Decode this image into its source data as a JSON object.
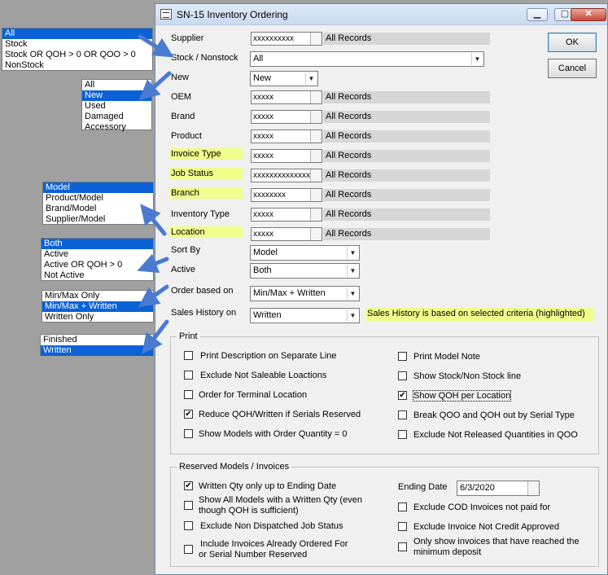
{
  "window": {
    "title": "SN-15  Inventory Ordering",
    "minimize": "▁",
    "maximize": "▢",
    "close": "✕"
  },
  "buttons": {
    "ok": "OK",
    "cancel": "Cancel"
  },
  "callouts": {
    "stock": [
      "All",
      "Stock",
      "Stock OR QOH > 0 OR QOO > 0",
      "NonStock"
    ],
    "new": [
      "All",
      "New",
      "Used",
      "Damaged",
      "Accessory"
    ],
    "sort": [
      "Model",
      "Product/Model",
      "Brand/Model",
      "Supplier/Model"
    ],
    "active": [
      "Both",
      "Active",
      "Active OR QOH > 0",
      "Not Active"
    ],
    "order": [
      "Min/Max Only",
      "Min/Max + Written",
      "Written Only"
    ],
    "history": [
      "Finished",
      "Written"
    ]
  },
  "fields": {
    "supplier": {
      "label": "Supplier",
      "code": "xxxxxxxxxx",
      "value": "All Records"
    },
    "stock": {
      "label": "Stock / Nonstock",
      "value": "All"
    },
    "new": {
      "label": "New",
      "value": "New"
    },
    "oem": {
      "label": "OEM",
      "code": "xxxxx",
      "value": "All Records"
    },
    "brand": {
      "label": "Brand",
      "code": "xxxxx",
      "value": "All Records"
    },
    "product": {
      "label": "Product",
      "code": "xxxxx",
      "value": "All Records"
    },
    "invoice_type": {
      "label": "Invoice Type",
      "code": "xxxxx",
      "value": "All Records"
    },
    "job_status": {
      "label": "Job Status",
      "code": "xxxxxxxxxxxxxxxx",
      "value": "All Records"
    },
    "branch": {
      "label": "Branch",
      "code": "xxxxxxxx",
      "value": "All Records"
    },
    "inventory_type": {
      "label": "Inventory Type",
      "code": "xxxxx",
      "value": "All Records"
    },
    "location": {
      "label": "Location",
      "code": "xxxxx",
      "value": "All Records"
    },
    "sort_by": {
      "label": "Sort By",
      "value": "Model"
    },
    "active": {
      "label": "Active",
      "value": "Both"
    },
    "order_based_on": {
      "label": "Order based on",
      "value": "Min/Max + Written"
    },
    "sales_history": {
      "label": "Sales History on",
      "value": "Written",
      "note": "Sales History is based on selected criteria (highlighted)"
    }
  },
  "print": {
    "title": "Print",
    "left": [
      {
        "label": "Print Description on Separate Line",
        "checked": false
      },
      {
        "label": "Exclude Not Saleable Loactions",
        "checked": false
      },
      {
        "label": "Order for Terminal Location",
        "checked": false
      },
      {
        "label": "Reduce QOH/Written if Serials Reserved",
        "checked": true
      },
      {
        "label": "Show Models with Order Quantity = 0",
        "checked": false
      }
    ],
    "right": [
      {
        "label": "Print Model Note",
        "checked": false
      },
      {
        "label": "Show Stock/Non Stock line",
        "checked": false
      },
      {
        "label": "Show QOH per Location",
        "checked": true
      },
      {
        "label": "Break QOO and QOH out by Serial Type",
        "checked": false
      },
      {
        "label": "Exclude Not Released Quantities in  QOO",
        "checked": false
      }
    ]
  },
  "reserved": {
    "title": "Reserved Models / Invoices",
    "written_qty": {
      "label": "Written Qty only up to Ending Date",
      "checked": true
    },
    "show_all_models": {
      "line1": "Show All Models with a Written Qty (even",
      "line2": "though QOH is sufficient)",
      "checked": false
    },
    "exclude_non_dispatched": {
      "label": "Exclude Non Dispatched Job Status",
      "checked": false
    },
    "include_invoices": {
      "line1": "Include Invoices Already Ordered For",
      "line2": "or Serial Number Reserved",
      "checked": false
    },
    "ending_date": {
      "label": "Ending Date",
      "value": "6/3/2020"
    },
    "exclude_cod": {
      "label": "Exclude COD Invoices not paid for",
      "checked": false
    },
    "exclude_not_credit": {
      "label": "Exclude Invoice Not Credit Approved",
      "checked": false
    },
    "min_deposit": {
      "line1": "Only show invoices that have reached the",
      "line2": "minimum deposit",
      "checked": false
    }
  },
  "check_glyph": "✔",
  "colors": {
    "highlight": "#f0fe8c",
    "selection": "#0a62d6",
    "arrow": "#4a7bd0"
  }
}
